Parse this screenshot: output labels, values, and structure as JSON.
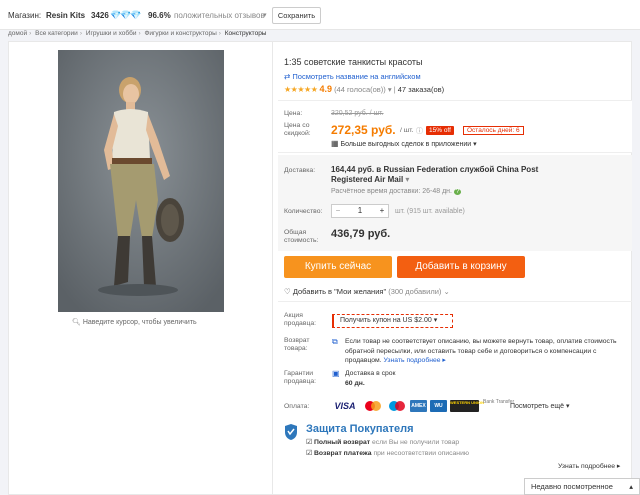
{
  "store": {
    "label": "Магазин:",
    "name": "Resin Kits",
    "score": "3426",
    "positive_pct": "96.6%",
    "positive_text": "положительных отзывов",
    "save_label": "Сохранить"
  },
  "breadcrumb": [
    "домой",
    "Все категории",
    "Игрушки и хобби",
    "Фигурки и конструкторы",
    "Конструкторы"
  ],
  "product": {
    "title": "1:35 советские танкисты красоты",
    "english_link": "Посмотреть название на английском",
    "rating": "4.9",
    "votes": "(44 голоса(ов))",
    "orders": "47 заказа(ов)",
    "zoom_hint": "Наведите курсор, чтобы увеличить"
  },
  "price": {
    "price_label": "Цена:",
    "old_price": "320,52 руб. / шт.",
    "discount_label": "Цена со скидкой:",
    "new_price": "272,35 руб.",
    "unit": "/ шт.",
    "discount_badge": "15% off",
    "days_left": "Осталось дней: 6",
    "more_deals": "Больше выгодных сделок в приложении"
  },
  "shipping": {
    "label": "Доставка:",
    "text": "164,44 руб. в Russian Federation службой China Post Registered Air Mail",
    "estimate": "Расчётное время доставки: 26-48 дн."
  },
  "quantity": {
    "label": "Количество:",
    "value": "1",
    "available": "шт. (915 шт. available)"
  },
  "total": {
    "label": "Общая стоимость:",
    "value": "436,79 руб."
  },
  "actions": {
    "buy_now": "Купить сейчас",
    "add_to_cart": "Добавить в корзину",
    "wishlist": "Добавить в \"Мои желания\"",
    "wishlist_count": "(300 добавили)"
  },
  "promo": {
    "label": "Акция продавца:",
    "coupon": "Получить купон на US $2.00"
  },
  "returns": {
    "label": "Возврат товара:",
    "text": "Если товар не соответствует описанию, вы можете вернуть товар, оплатив стоимость обратной пересылки, или оставить товар себе и договориться о компенсации с продавцом.",
    "more": "Узнать подробнее"
  },
  "guarantee": {
    "label": "Гарантии продавца:",
    "text": "Доставка в срок",
    "days": "60 дн."
  },
  "payment": {
    "label": "Оплата:",
    "logos": [
      "VISA",
      "MC",
      "Maestro",
      "AMEX",
      "WU",
      "WESTERN UNION",
      "Bank Transfer"
    ],
    "more": "Посмотреть ещё"
  },
  "protection": {
    "title": "Защита Покупателя",
    "item1_bold": "Полный возврат",
    "item1_rest": "если Вы не получили товар",
    "item2_bold": "Возврат платежа",
    "item2_rest": "при несоответствии описанию",
    "more": "Узнать подробнее"
  },
  "recent": "Недавно посмотренное",
  "colors": {
    "accent_orange": "#f57c00",
    "buy_orange": "#f7931e",
    "cart_red_orange": "#f35f11",
    "link_blue": "#1f5fcf",
    "badge_red": "#e62e04"
  }
}
